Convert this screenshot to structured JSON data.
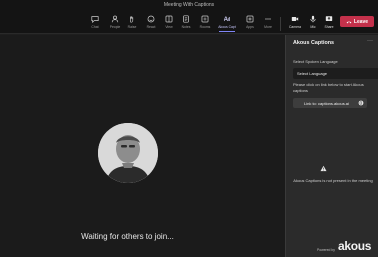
{
  "window": {
    "title": "Meeting With Captions"
  },
  "toolbar": {
    "items": [
      {
        "label": "Chat",
        "icon": "chat-icon"
      },
      {
        "label": "People",
        "icon": "people-icon"
      },
      {
        "label": "Raise",
        "icon": "raise-hand-icon"
      },
      {
        "label": "React",
        "icon": "react-icon"
      },
      {
        "label": "View",
        "icon": "view-icon"
      },
      {
        "label": "Notes",
        "icon": "notes-icon"
      },
      {
        "label": "Rooms",
        "icon": "rooms-icon"
      },
      {
        "label": "Akous Capt",
        "icon": "akous-captions-icon"
      },
      {
        "label": "Apps",
        "icon": "apps-icon"
      },
      {
        "label": "More",
        "icon": "more-icon"
      }
    ],
    "device": {
      "camera_label": "Camera",
      "mic_label": "Mic",
      "share_label": "Share"
    },
    "leave_label": "Leave",
    "accent": "#c4314b"
  },
  "stage": {
    "waiting_text": "Waiting for others to join..."
  },
  "panel": {
    "title": "Akous Captions",
    "more": "···",
    "language_label": "Select Spoken Language",
    "language_value": "Select Language",
    "help_text": "Please click on link below to start Akous captions",
    "link_label": "Link to: captions.akous.ai",
    "warning_text": "Akous Captions is not present in the meeting",
    "powered_by": "Powered by",
    "logo_text": "akous"
  }
}
